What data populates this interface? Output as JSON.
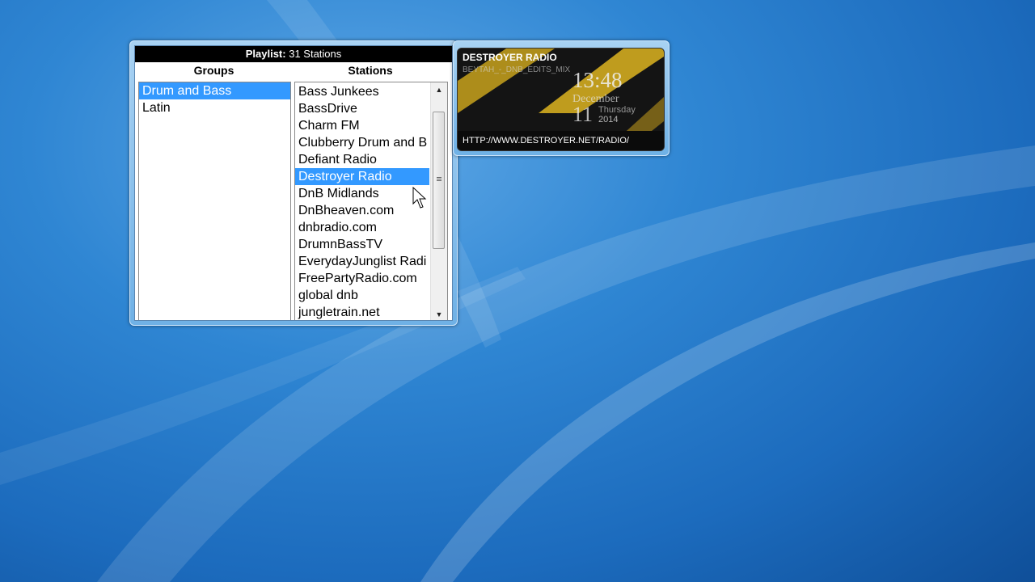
{
  "playlist": {
    "header_label": "Playlist:",
    "header_count": "31 Stations",
    "groups_heading": "Groups",
    "stations_heading": "Stations",
    "groups": [
      {
        "label": "Drum and Bass",
        "selected": true
      },
      {
        "label": "Latin",
        "selected": false
      }
    ],
    "stations": [
      {
        "label": "Bass Junkees",
        "selected": false
      },
      {
        "label": "BassDrive",
        "selected": false
      },
      {
        "label": "Charm FM",
        "selected": false
      },
      {
        "label": "Clubberry Drum and B",
        "selected": false
      },
      {
        "label": "Defiant Radio",
        "selected": false
      },
      {
        "label": "Destroyer Radio",
        "selected": true
      },
      {
        "label": "DnB Midlands",
        "selected": false
      },
      {
        "label": "DnBheaven.com",
        "selected": false
      },
      {
        "label": "dnbradio.com",
        "selected": false
      },
      {
        "label": "DrumnBassTV",
        "selected": false
      },
      {
        "label": "EverydayJunglist Radi",
        "selected": false
      },
      {
        "label": "FreePartyRadio.com",
        "selected": false
      },
      {
        "label": "global dnb",
        "selected": false
      },
      {
        "label": "jungletrain.net",
        "selected": false
      }
    ]
  },
  "now_playing": {
    "station": "DESTROYER RADIO",
    "track": "BEYTAH_-_DNB_EDITS_MIX",
    "time": "13:48",
    "month": "December",
    "day": "11",
    "weekday": "Thursday",
    "year": "2014",
    "url": "HTTP://WWW.DESTROYER.NET/RADIO/"
  },
  "colors": {
    "selection": "#3399ff",
    "accent_yellow": "#c8a21c"
  }
}
